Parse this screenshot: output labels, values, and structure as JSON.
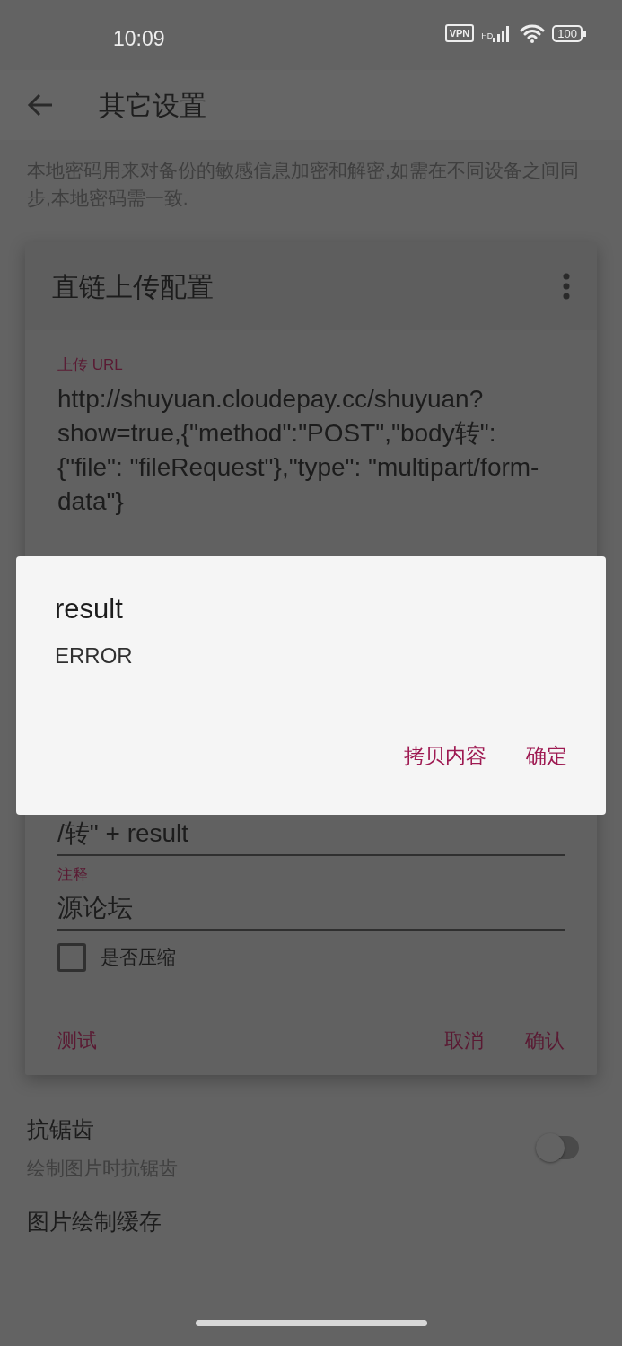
{
  "status_bar": {
    "time": "10:09",
    "vpn": "VPN",
    "network": "HD",
    "battery": "100"
  },
  "app_bar": {
    "title": "其它设置"
  },
  "intro": "本地密码用来对备份的敏感信息加密和解密,如需在不同设备之间同步,本地密码需一致.",
  "config_card": {
    "title": "直链上传配置",
    "fields": [
      {
        "label": "上传 URL",
        "value": "http://shuyuan.cloudepay.cc/shuyuan?show=true,{\"method\":\"POST\",\"body转\": {\"file\": \"fileRequest\"},\"type\": \"multipart/form-data\"}"
      },
      {
        "value": "/转\" + result"
      },
      {
        "label": "注释",
        "value": "源论坛"
      }
    ],
    "checkbox": {
      "label": "是否压缩",
      "checked": false
    },
    "buttons": [
      "测试",
      "取消",
      "确认"
    ]
  },
  "settings": [
    {
      "title": "抗锯齿",
      "summary": "绘制图片时抗锯齿",
      "on": false
    },
    {
      "title": "图片绘制缓存"
    }
  ],
  "dialog": {
    "title": "result",
    "message": "ERROR",
    "buttons": [
      "拷贝内容",
      "确定"
    ]
  }
}
